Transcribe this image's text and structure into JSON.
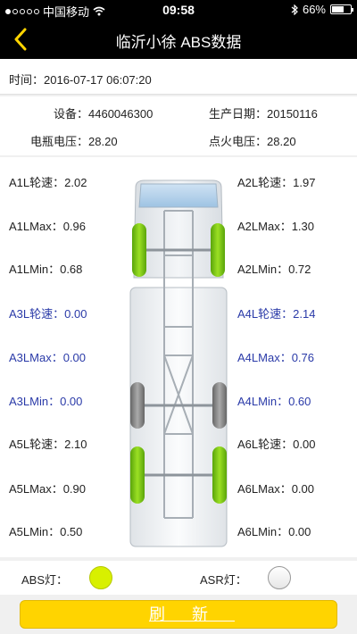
{
  "status_bar": {
    "carrier": "中国移动",
    "time": "09:58",
    "battery": "66%",
    "battery_level": 0.66
  },
  "nav": {
    "title": "临沂小徐  ABS数据"
  },
  "time_row": {
    "label": "时间：",
    "value": "2016-07-17 06:07:20"
  },
  "info": {
    "device_label": "设备：",
    "device_value": "4460046300",
    "prod_date_label": "生产日期：",
    "prod_date_value": "20150116",
    "battery_voltage_label": "电瓶电压：",
    "battery_voltage_value": "28.20",
    "ignition_voltage_label": "点火电压：",
    "ignition_voltage_value": "28.20"
  },
  "wheels": {
    "left": [
      {
        "label": "A1L轮速：",
        "value": "2.02",
        "blue": false
      },
      {
        "label": "A1LMax：",
        "value": "0.96",
        "blue": false
      },
      {
        "label": "A1LMin：",
        "value": "0.68",
        "blue": false
      },
      {
        "label": "A3L轮速：",
        "value": "0.00",
        "blue": true
      },
      {
        "label": "A3LMax：",
        "value": "0.00",
        "blue": true
      },
      {
        "label": "A3LMin：",
        "value": "0.00",
        "blue": true
      },
      {
        "label": "A5L轮速：",
        "value": "2.10",
        "blue": false
      },
      {
        "label": "A5LMax：",
        "value": "0.90",
        "blue": false
      },
      {
        "label": "A5LMin：",
        "value": "0.50",
        "blue": false
      }
    ],
    "right": [
      {
        "label": "A2L轮速：",
        "value": "1.97",
        "blue": false
      },
      {
        "label": "A2LMax：",
        "value": "1.30",
        "blue": false
      },
      {
        "label": "A2LMin：",
        "value": "0.72",
        "blue": false
      },
      {
        "label": "A4L轮速：",
        "value": "2.14",
        "blue": true
      },
      {
        "label": "A4LMax：",
        "value": "0.76",
        "blue": true
      },
      {
        "label": "A4LMin：",
        "value": "0.60",
        "blue": true
      },
      {
        "label": "A6L轮速：",
        "value": "0.00",
        "blue": false
      },
      {
        "label": "A6LMax：",
        "value": "0.00",
        "blue": false
      },
      {
        "label": "A6LMin：",
        "value": "0.00",
        "blue": false
      }
    ]
  },
  "lights": {
    "abs_label": "ABS灯：",
    "abs_state": "on",
    "asr_label": "ASR灯：",
    "asr_state": "off"
  },
  "refresh_label": "刷新",
  "colors": {
    "wheel_active": "#7ec812",
    "wheel_inactive": "#8a8a8a",
    "highlight_text": "#2a3aa8",
    "button": "#ffd400",
    "abs_lamp_on": "#d8f000"
  }
}
